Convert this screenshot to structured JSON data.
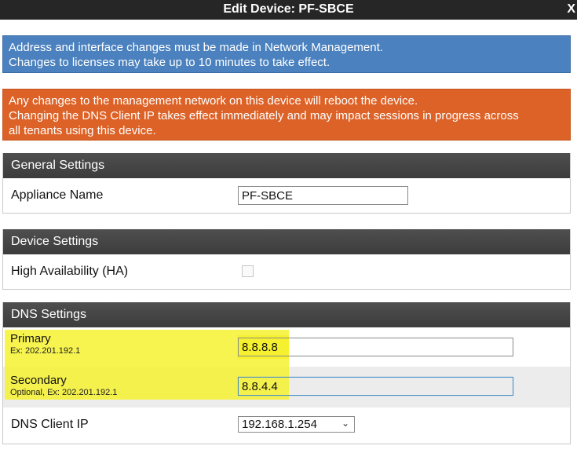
{
  "dialog": {
    "title": "Edit Device: PF-SBCE",
    "close_label": "X"
  },
  "alerts": {
    "info": {
      "line1": "Address and interface changes must be made in Network Management.",
      "line2": "Changes to licenses may take up to 10 minutes to take effect."
    },
    "warning": {
      "line1": "Any changes to the management network on this device will reboot the device.",
      "line2": "Changing the DNS Client IP takes effect immediately and may impact sessions in progress across",
      "line3": "all tenants using this device."
    }
  },
  "general": {
    "header": "General Settings",
    "appliance_name_label": "Appliance Name",
    "appliance_name_value": "PF-SBCE"
  },
  "device": {
    "header": "Device Settings",
    "ha_label": "High Availability (HA)",
    "ha_checked": false
  },
  "dns": {
    "header": "DNS Settings",
    "primary_label": "Primary",
    "primary_hint": "Ex: 202.201.192.1",
    "primary_value": "8.8.8.8",
    "secondary_label": "Secondary",
    "secondary_hint": "Optional, Ex: 202.201.192.1",
    "secondary_value": "8.8.4.4",
    "client_ip_label": "DNS Client IP",
    "client_ip_selected": "192.168.1.254"
  },
  "colors": {
    "title_bar": "#262626",
    "info": "#4a81be",
    "warning": "#dd6227",
    "panel_header": "#444444",
    "highlight": "#f5f028"
  }
}
